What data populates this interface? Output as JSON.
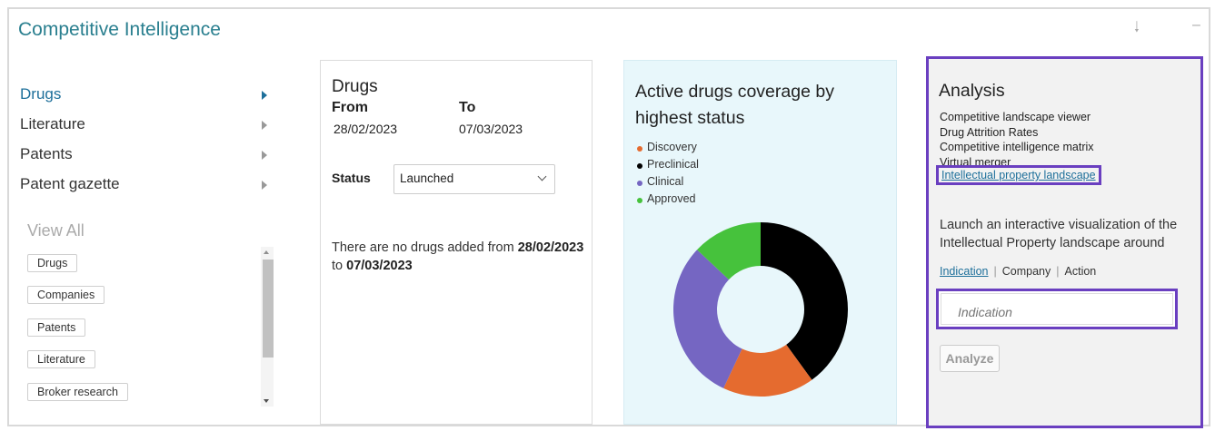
{
  "panel": {
    "title": "Competitive Intelligence",
    "download_icon": "download-arrow-icon",
    "minimize_icon": "minimize-icon"
  },
  "nav": {
    "items": [
      {
        "label": "Drugs",
        "active": true
      },
      {
        "label": "Literature",
        "active": false
      },
      {
        "label": "Patents",
        "active": false
      },
      {
        "label": "Patent gazette",
        "active": false
      }
    ],
    "view_all": "View All",
    "tags": [
      "Drugs",
      "Companies",
      "Patents",
      "Literature",
      "Broker research"
    ]
  },
  "drugs_card": {
    "title": "Drugs",
    "from_label": "From",
    "to_label": "To",
    "from_value": "28/02/2023",
    "to_value": "07/03/2023",
    "status_label": "Status",
    "status_value": "Launched",
    "empty_prefix": "There are no drugs added from ",
    "empty_from": "28/02/2023",
    "empty_middle": " to ",
    "empty_to": "07/03/2023"
  },
  "chart_data": {
    "type": "pie",
    "title": "Active drugs coverage by highest status",
    "legend_position": "top-left",
    "categories": [
      "Discovery",
      "Preclinical",
      "Clinical",
      "Approved"
    ],
    "values": [
      17,
      40,
      30,
      13
    ],
    "colors": [
      "#e56b2f",
      "#000000",
      "#7566c2",
      "#46c23c"
    ],
    "hole": 0.5
  },
  "analysis": {
    "title": "Analysis",
    "links": [
      "Competitive landscape viewer",
      "Drug Attrition Rates",
      "Competitive intelligence matrix",
      "Virtual merger"
    ],
    "highlight_link": "Intellectual property landscape",
    "description": "Launch an interactive visualization of the Intellectual Property landscape around",
    "modes": [
      "Indication",
      "Company",
      "Action"
    ],
    "mode_sep": "|",
    "input_placeholder": "Indication",
    "analyze_label": "Analyze",
    "highlight_color": "#6a3fc0"
  }
}
